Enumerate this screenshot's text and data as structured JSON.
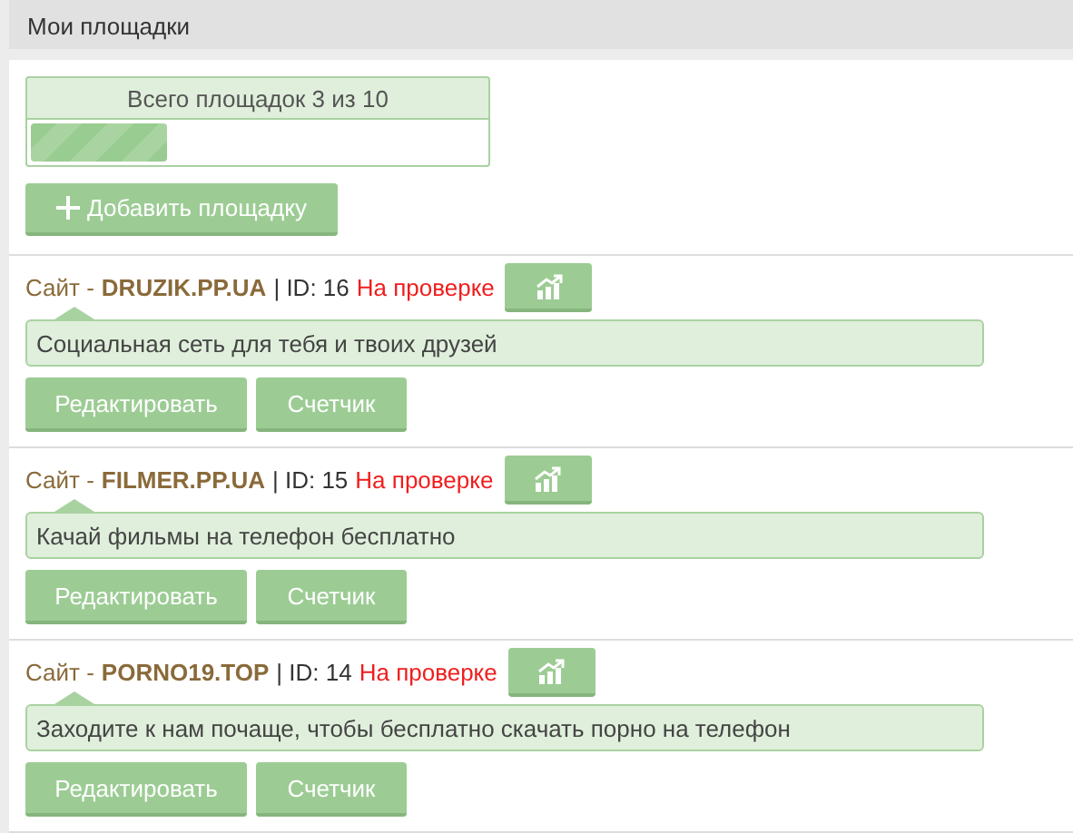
{
  "header": {
    "title": "Мои площадки"
  },
  "quota": {
    "label": "Всего площадок 3 из 10",
    "level": 0.3
  },
  "add_button": {
    "label": "Добавить площадку"
  },
  "sites": [
    {
      "prefix": "Сайт -",
      "name": "DRUZIK.PP.UA",
      "id": "| ID: 16",
      "status": "На проверке",
      "description": "Социальная сеть для тебя и твоих друзей",
      "buttons": [
        "Редактировать",
        "Счетчик"
      ]
    },
    {
      "prefix": "Сайт -",
      "name": "FILMER.PP.UA",
      "id": "| ID: 15",
      "status": "На проверке",
      "description": "Качай фильмы на телефон бесплатно",
      "buttons": [
        "Редактировать",
        "Счетчик"
      ]
    },
    {
      "prefix": "Сайт -",
      "name": "PORNO19.TOP",
      "id": "| ID: 14",
      "status": "На проверке",
      "description": "Заходите к нам почаще, чтобы бесплатно скачать порно на телефон",
      "buttons": [
        "Редактировать",
        "Счетчик"
      ]
    }
  ]
}
